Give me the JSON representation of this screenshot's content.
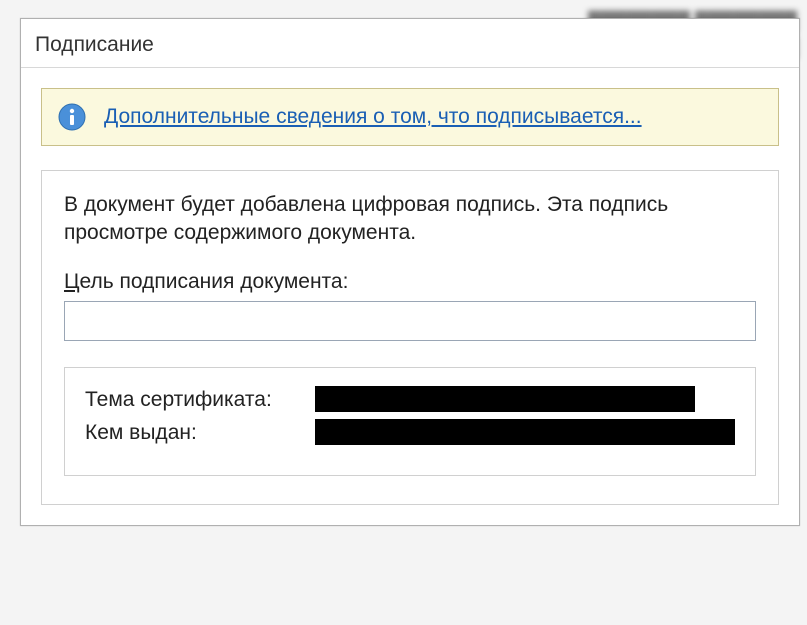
{
  "dialog": {
    "title": "Подписание",
    "info_link": "Дополнительные сведения о том, что подписывается...",
    "description": "В документ будет добавлена цифровая подпись. Эта подпись просмотре содержимого документа.",
    "purpose_label_accel": "Ц",
    "purpose_label_rest": "ель подписания документа:",
    "purpose_value": "",
    "cert_subject_label": "Тема сертификата:",
    "cert_subject_value": "████████████████",
    "cert_issuer_label": "Кем выдан:",
    "cert_issuer_value": "█████████████████████"
  }
}
